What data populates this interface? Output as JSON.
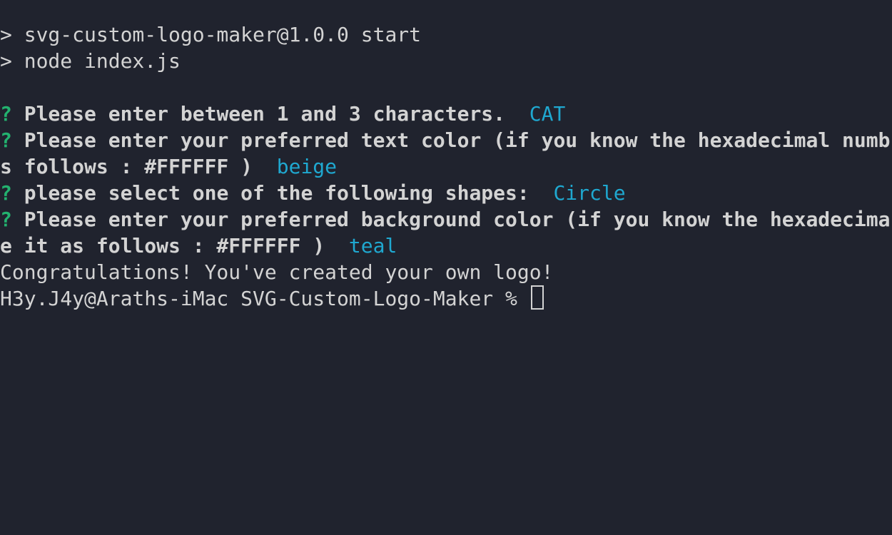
{
  "colors": {
    "background": "#20232e",
    "text": "#d3d3d3",
    "prompt_marker": "#23b26f",
    "answer": "#1fa8d0"
  },
  "npm": {
    "script_line": "> svg-custom-logo-maker@1.0.0 start",
    "command_line": "> node index.js"
  },
  "prompts": {
    "marker": "?",
    "characters_question": "Please enter between 1 and 3 characters.",
    "characters_answer": "CAT",
    "text_color_question_line1": "Please enter your preferred text color (if you know the hexadecimal numb",
    "text_color_question_line2": "s follows : #FFFFFF )",
    "text_color_answer": "beige",
    "shape_question": "please select one of the following shapes:",
    "shape_answer": "Circle",
    "bg_color_question_line1": "Please enter your preferred background color (if you know the hexadecima",
    "bg_color_question_line2": "e it as follows : #FFFFFF )",
    "bg_color_answer": "teal"
  },
  "output": {
    "success_message": "Congratulations! You've created your own logo!"
  },
  "shell": {
    "prompt": "H3y.J4y@Araths-iMac SVG-Custom-Logo-Maker %"
  }
}
